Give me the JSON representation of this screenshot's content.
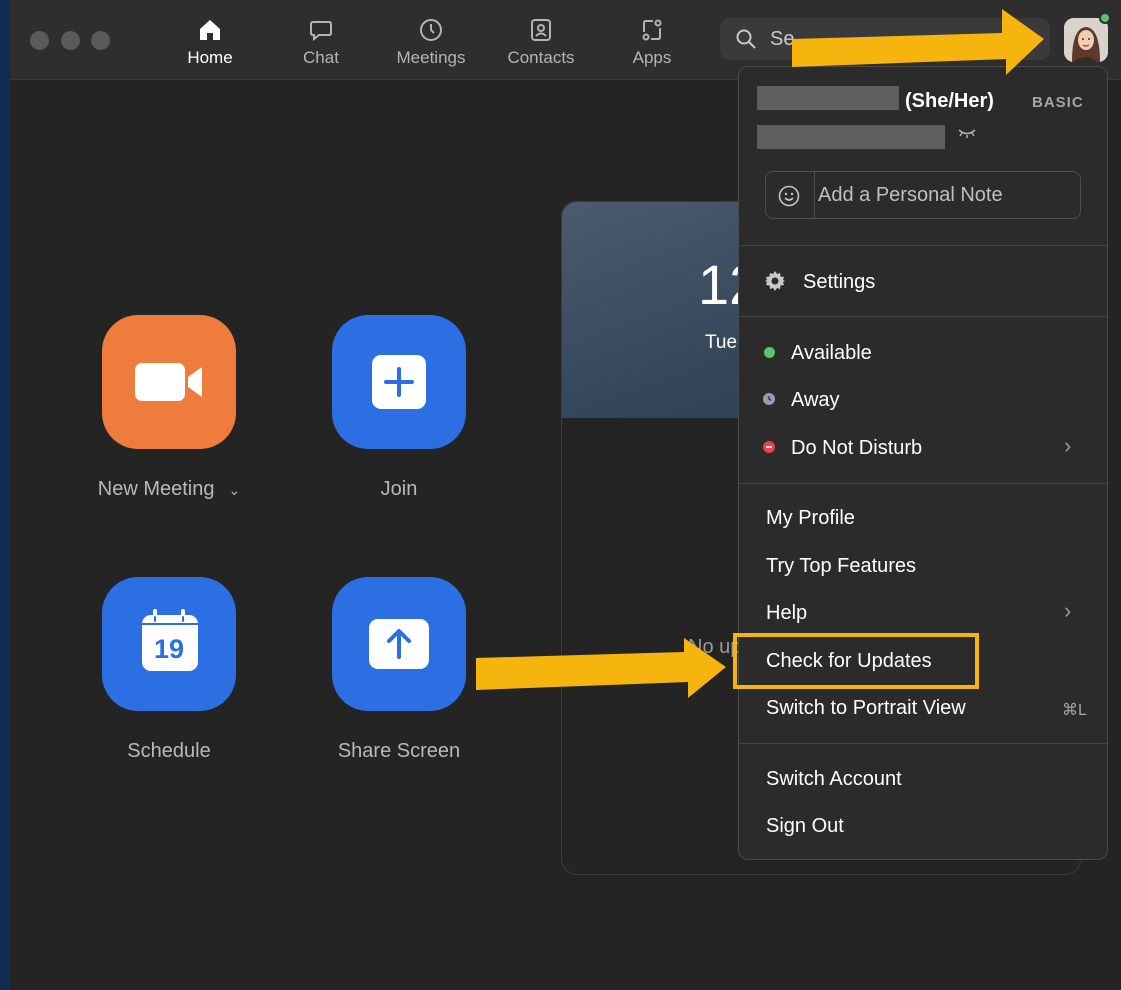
{
  "nav": {
    "home": "Home",
    "chat": "Chat",
    "meetings": "Meetings",
    "contacts": "Contacts",
    "apps": "Apps"
  },
  "search": {
    "placeholder": "Se"
  },
  "tiles": {
    "new_meeting": "New Meeting",
    "join": "Join",
    "schedule": "Schedule",
    "share_screen": "Share Screen",
    "calendar_day": "19"
  },
  "calendar_panel": {
    "time": "12",
    "date": "Tue",
    "empty": "No up"
  },
  "profile_menu": {
    "pronouns": "(She/Her)",
    "plan": "BASIC",
    "note_placeholder": "Add a Personal Note",
    "settings": "Settings",
    "status": {
      "available": "Available",
      "away": "Away",
      "dnd": "Do Not Disturb"
    },
    "items": {
      "my_profile": "My Profile",
      "try_top_features": "Try Top Features",
      "help": "Help",
      "check_updates": "Check for Updates",
      "portrait_view": "Switch to Portrait View",
      "portrait_shortcut": "⌘L",
      "switch_account": "Switch Account",
      "sign_out": "Sign Out"
    }
  },
  "colors": {
    "accent_blue": "#2c6fe2",
    "accent_orange": "#ee7c3c",
    "annotation": "#f6b40e",
    "available": "#5dc46a",
    "away": "#9a9ab0",
    "dnd": "#e8434d"
  }
}
